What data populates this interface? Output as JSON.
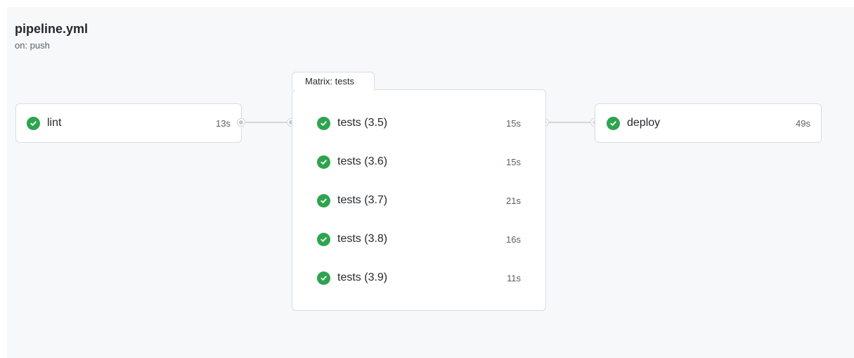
{
  "workflow": {
    "title": "pipeline.yml",
    "trigger": "on: push"
  },
  "jobs": {
    "lint": {
      "name": "lint",
      "duration": "13s",
      "status": "success"
    },
    "deploy": {
      "name": "deploy",
      "duration": "49s",
      "status": "success"
    }
  },
  "matrix": {
    "label": "Matrix: tests",
    "jobs": [
      {
        "name": "tests (3.5)",
        "duration": "15s",
        "status": "success"
      },
      {
        "name": "tests (3.6)",
        "duration": "15s",
        "status": "success"
      },
      {
        "name": "tests (3.7)",
        "duration": "21s",
        "status": "success"
      },
      {
        "name": "tests (3.8)",
        "duration": "16s",
        "status": "success"
      },
      {
        "name": "tests (3.9)",
        "duration": "11s",
        "status": "success"
      }
    ]
  },
  "colors": {
    "success": "#2da44e",
    "background": "#f6f8fa",
    "border": "#d8dee4",
    "connector": "#d0d7de"
  },
  "icons": {
    "status": "check-circle-icon"
  }
}
